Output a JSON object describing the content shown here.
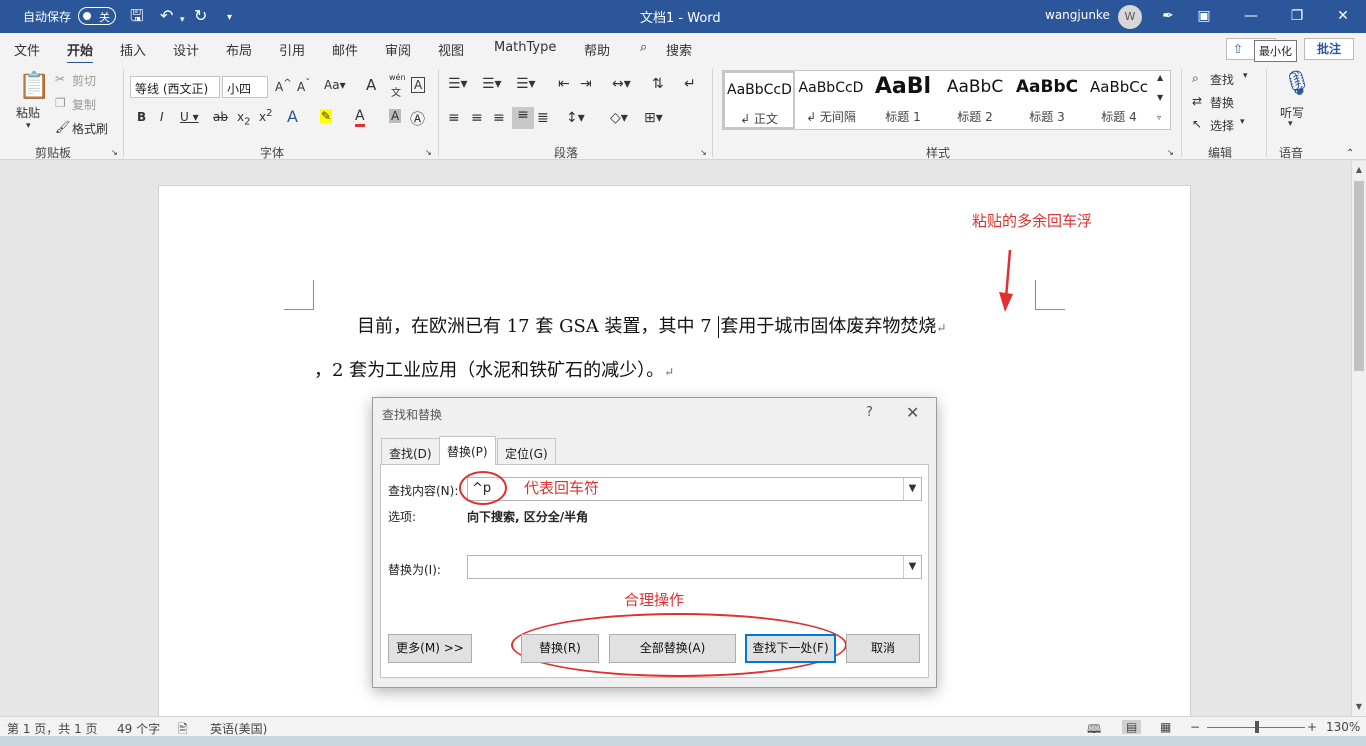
{
  "titlebar": {
    "autosave_label": "自动保存",
    "autosave_state": "关",
    "doc_title": "文档1  -  Word",
    "user_name": "wangjunke",
    "avatar_initial": "W"
  },
  "menu": {
    "tabs": [
      "文件",
      "开始",
      "插入",
      "设计",
      "布局",
      "引用",
      "邮件",
      "审阅",
      "视图",
      "MathType",
      "帮助"
    ],
    "search_label": "搜索",
    "share_label": "共享",
    "minimize_tooltip": "最小化",
    "comments_label": "批注"
  },
  "ribbon": {
    "clipboard": {
      "paste": "粘贴",
      "cut": "剪切",
      "copy": "复制",
      "format_painter": "格式刷",
      "group": "剪贴板"
    },
    "font": {
      "font_name": "等线 (西文正)",
      "font_size": "小四",
      "group": "字体",
      "phonetic_top": "wén",
      "phonetic_bottom": "文"
    },
    "paragraph": {
      "group": "段落"
    },
    "styles": {
      "items": [
        {
          "sample": "AaBbCcD",
          "name": "↲ 正文"
        },
        {
          "sample": "AaBbCcD",
          "name": "↲ 无间隔"
        },
        {
          "sample": "AaBl",
          "name": "标题 1"
        },
        {
          "sample": "AaBbC",
          "name": "标题 2"
        },
        {
          "sample": "AaBbC",
          "name": "标题 3"
        },
        {
          "sample": "AaBbCc",
          "name": "标题 4"
        }
      ],
      "group": "样式"
    },
    "editing": {
      "find": "查找",
      "replace": "替换",
      "select": "选择",
      "group": "编辑"
    },
    "voice": {
      "dictate": "听写",
      "group": "语音"
    }
  },
  "document": {
    "line1": "目前，在欧洲已有 17 套 GSA 装置，其中 7 ",
    "line1b": "套用于城市固体废弃物焚烧",
    "line2": "，2 套为工业应用（水泥和铁矿石的减少）。",
    "para_mark": "↵"
  },
  "annotations": {
    "top": "粘贴的多余回车浮",
    "find_note": "代表回车符",
    "buttons_note": "合理操作"
  },
  "dialog": {
    "title": "查找和替换",
    "help": "?",
    "close": "✕",
    "tabs": [
      "查找(D)",
      "替换(P)",
      "定位(G)"
    ],
    "find_label": "查找内容(N):",
    "find_value": "^p",
    "options_label": "选项:",
    "options_value": "向下搜索, 区分全/半角",
    "replace_label": "替换为(I):",
    "replace_value": "",
    "more_button": "更多(M) >>",
    "replace_button": "替换(R)",
    "replace_all_button": "全部替换(A)",
    "find_next_button": "查找下一处(F)",
    "cancel_button": "取消"
  },
  "statusbar": {
    "page": "第 1 页，共 1 页",
    "words": "49 个字",
    "language": "英语(美国)",
    "zoom": "130%"
  },
  "colors": {
    "title_bar": "#2b579a",
    "annotation": "#e03030",
    "focus": "#0078d7"
  }
}
